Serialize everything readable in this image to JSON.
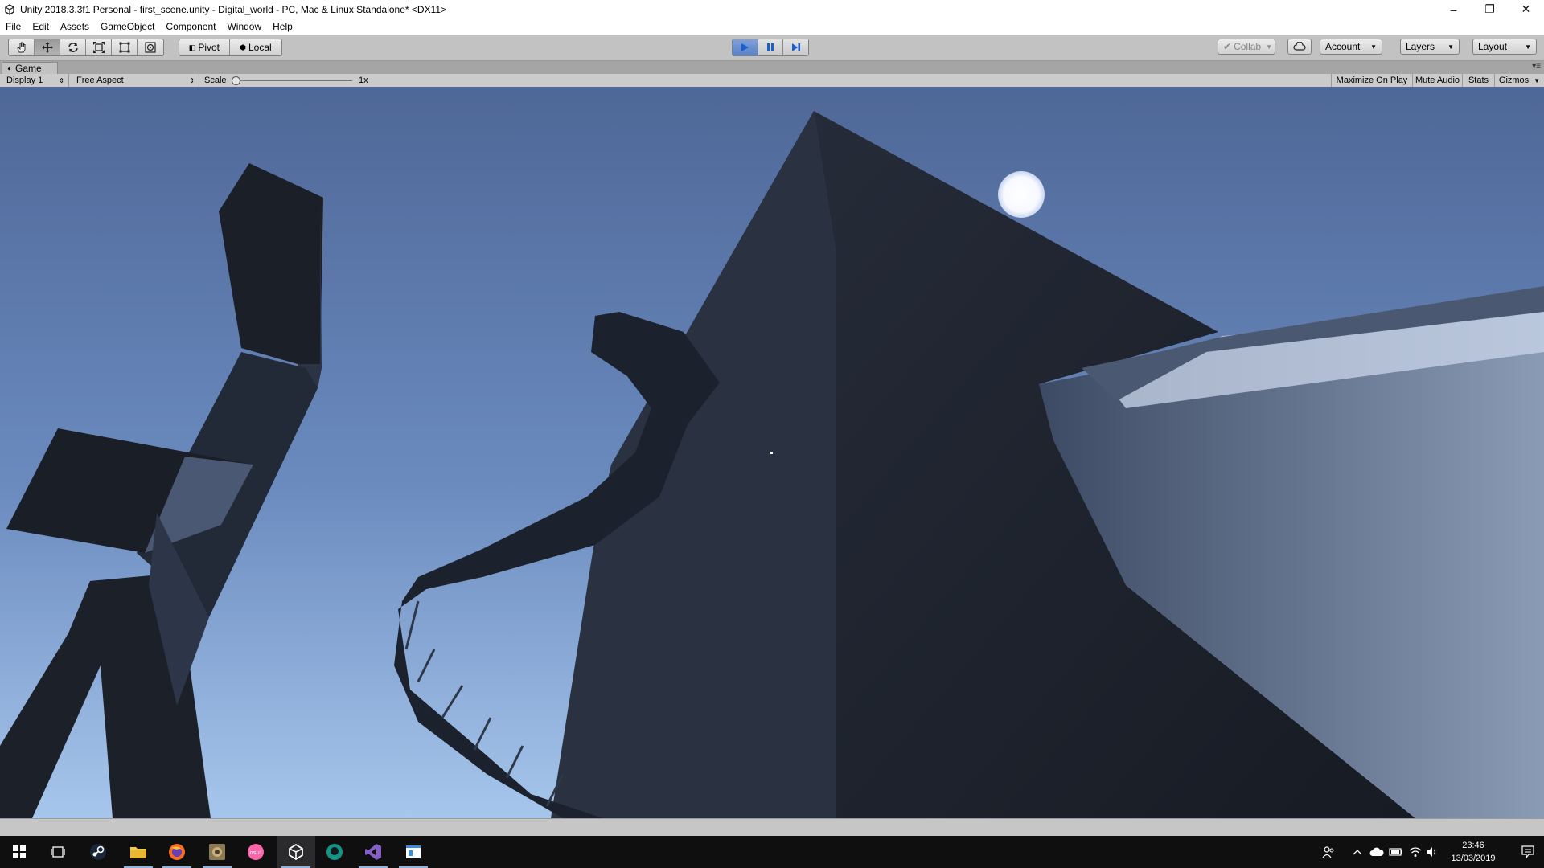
{
  "window": {
    "title": "Unity 2018.3.3f1 Personal - first_scene.unity - Digital_world - PC, Mac & Linux Standalone* <DX11>",
    "controls": {
      "minimize": "–",
      "restore": "❐",
      "close": "✕"
    }
  },
  "menu": [
    "File",
    "Edit",
    "Assets",
    "GameObject",
    "Component",
    "Window",
    "Help"
  ],
  "toolbar": {
    "tools": [
      "hand-tool",
      "move-tool",
      "rotate-tool",
      "scale-tool",
      "rect-tool",
      "transform-tool"
    ],
    "active_tool": "move-tool",
    "pivot_label": "Pivot",
    "local_label": "Local",
    "play_state": "playing",
    "collab_label": "Collab",
    "account_label": "Account",
    "layers_label": "Layers",
    "layout_label": "Layout"
  },
  "game_view": {
    "tab_label": "Game",
    "display_label": "Display 1",
    "aspect_label": "Free Aspect",
    "scale_label": "Scale",
    "scale_value": "1x",
    "maximize_label": "Maximize On Play",
    "mute_label": "Mute Audio",
    "stats_label": "Stats",
    "gizmos_label": "Gizmos"
  },
  "taskbar": {
    "apps": [
      "windows-start",
      "task-view",
      "steam",
      "file-explorer",
      "firefox",
      "photo-app",
      "osu",
      "unity",
      "gitkraken",
      "visual-studio",
      "notepad-app"
    ],
    "time": "23:46",
    "date": "13/03/2019"
  },
  "colors": {
    "sky_top": "#4e6797",
    "sky_bottom": "#a7c6ec",
    "structure_dark": "#1c2029",
    "play_accent": "#5b82c6"
  }
}
